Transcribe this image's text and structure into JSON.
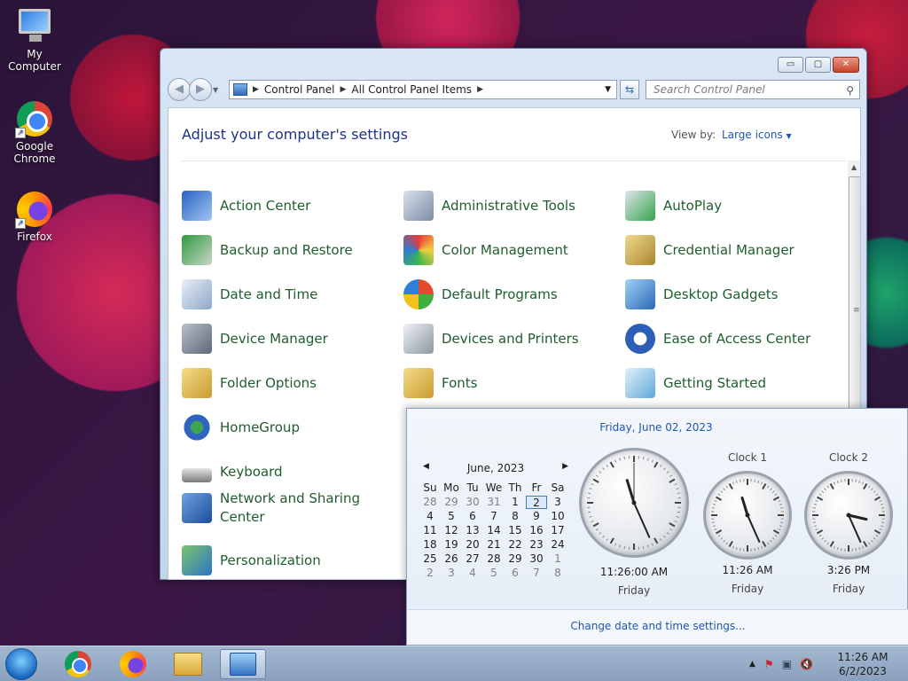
{
  "desktop": {
    "icons": [
      {
        "label": "My Computer",
        "icon": "computer-icon"
      },
      {
        "label": "Google Chrome",
        "icon": "chrome-icon"
      },
      {
        "label": "Firefox",
        "icon": "firefox-icon"
      }
    ]
  },
  "window": {
    "title": "All Control Panel Items",
    "breadcrumb": [
      "Control Panel",
      "All Control Panel Items"
    ],
    "search_placeholder": "Search Control Panel",
    "heading": "Adjust your computer's settings",
    "view_by_label": "View by:",
    "view_by_value": "Large icons",
    "items": [
      {
        "label": "Action Center",
        "icon": "flag-icon"
      },
      {
        "label": "Administrative Tools",
        "icon": "admin-tools-icon"
      },
      {
        "label": "AutoPlay",
        "icon": "autoplay-icon"
      },
      {
        "label": "Backup and Restore",
        "icon": "backup-icon"
      },
      {
        "label": "Color Management",
        "icon": "color-management-icon"
      },
      {
        "label": "Credential Manager",
        "icon": "credential-icon"
      },
      {
        "label": "Date and Time",
        "icon": "calendar-clock-icon"
      },
      {
        "label": "Default Programs",
        "icon": "default-programs-icon"
      },
      {
        "label": "Desktop Gadgets",
        "icon": "gadgets-icon"
      },
      {
        "label": "Device Manager",
        "icon": "device-manager-icon"
      },
      {
        "label": "Devices and Printers",
        "icon": "printer-icon"
      },
      {
        "label": "Ease of Access Center",
        "icon": "ease-of-access-icon"
      },
      {
        "label": "Folder Options",
        "icon": "folder-options-icon"
      },
      {
        "label": "Fonts",
        "icon": "fonts-icon"
      },
      {
        "label": "Getting Started",
        "icon": "getting-started-icon"
      },
      {
        "label": "HomeGroup",
        "icon": "homegroup-icon"
      },
      {
        "label": "Keyboard",
        "icon": "keyboard-icon"
      },
      {
        "label": "Network and Sharing",
        "label2": "Center",
        "icon": "network-icon"
      },
      {
        "label": "Personalization",
        "icon": "personalization-icon"
      }
    ]
  },
  "datetime_popup": {
    "long_date": "Friday, June 02, 2023",
    "calendar": {
      "month_label": "June, 2023",
      "days_of_week": [
        "Su",
        "Mo",
        "Tu",
        "We",
        "Th",
        "Fr",
        "Sa"
      ],
      "weeks": [
        [
          "28",
          "29",
          "30",
          "31",
          "1",
          "2",
          "3"
        ],
        [
          "4",
          "5",
          "6",
          "7",
          "8",
          "9",
          "10"
        ],
        [
          "11",
          "12",
          "13",
          "14",
          "15",
          "16",
          "17"
        ],
        [
          "18",
          "19",
          "20",
          "21",
          "22",
          "23",
          "24"
        ],
        [
          "25",
          "26",
          "27",
          "28",
          "29",
          "30",
          "1"
        ],
        [
          "2",
          "3",
          "4",
          "5",
          "6",
          "7",
          "8"
        ]
      ],
      "selected_day": "2"
    },
    "clocks": [
      {
        "name": "",
        "time": "11:26:00 AM",
        "day": "Friday",
        "hour": 11,
        "minute": 26,
        "second": 0
      },
      {
        "name": "Clock 1",
        "time": "11:26 AM",
        "day": "Friday",
        "hour": 11,
        "minute": 26
      },
      {
        "name": "Clock 2",
        "time": "3:26 PM",
        "day": "Friday",
        "hour": 15,
        "minute": 26
      }
    ],
    "change_link": "Change date and time settings..."
  },
  "taskbar": {
    "time": "11:26 AM",
    "date": "6/2/2023"
  }
}
